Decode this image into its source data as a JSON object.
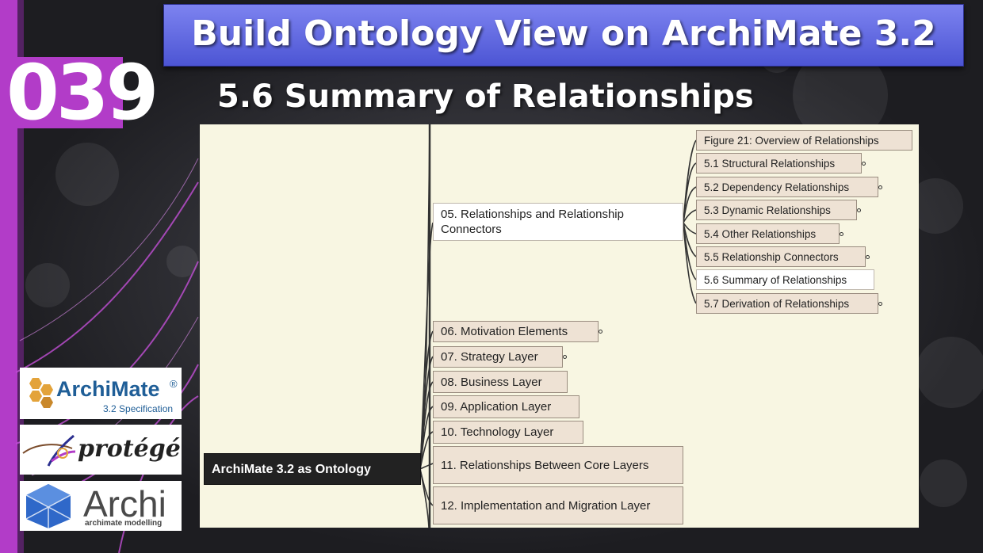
{
  "slide": {
    "title": "Build Ontology View on ArchiMate 3.2",
    "episode": "039",
    "subtitle": "5.6 Summary of Relationships"
  },
  "mindmap": {
    "root": "ArchiMate 3.2 as Ontology",
    "section_05": "05. Relationships and Relationship Connectors",
    "section_05_children": [
      "Figure 21: Overview of Relationships",
      "5.1 Structural Relationships",
      "5.2 Dependency Relationships",
      "5.3 Dynamic Relationships",
      "5.4 Other Relationships",
      "5.5 Relationship Connectors",
      "5.6 Summary of Relationships",
      "5.7 Derivation of Relationships"
    ],
    "sections": [
      "06. Motivation Elements",
      "07. Strategy Layer",
      "08. Business Layer",
      "09. Application Layer",
      "10. Technology Layer",
      "11. Relationships Between Core Layers",
      "12. Implementation and Migration Layer"
    ],
    "selected": "5.6 Summary of Relationships"
  },
  "logos": {
    "archimate": {
      "name": "ArchiMate",
      "registered": "®",
      "caption": "3.2 Specification"
    },
    "protege": {
      "name": "protégé"
    },
    "archi": {
      "name": "Archi",
      "caption": "archimate modelling"
    }
  },
  "colors": {
    "banner": "#5a62e0",
    "node_fill": "#eee2d4",
    "panel_bg": "#f8f6e2",
    "root_fill": "#222222",
    "accent_purple": "#b23cc8"
  }
}
